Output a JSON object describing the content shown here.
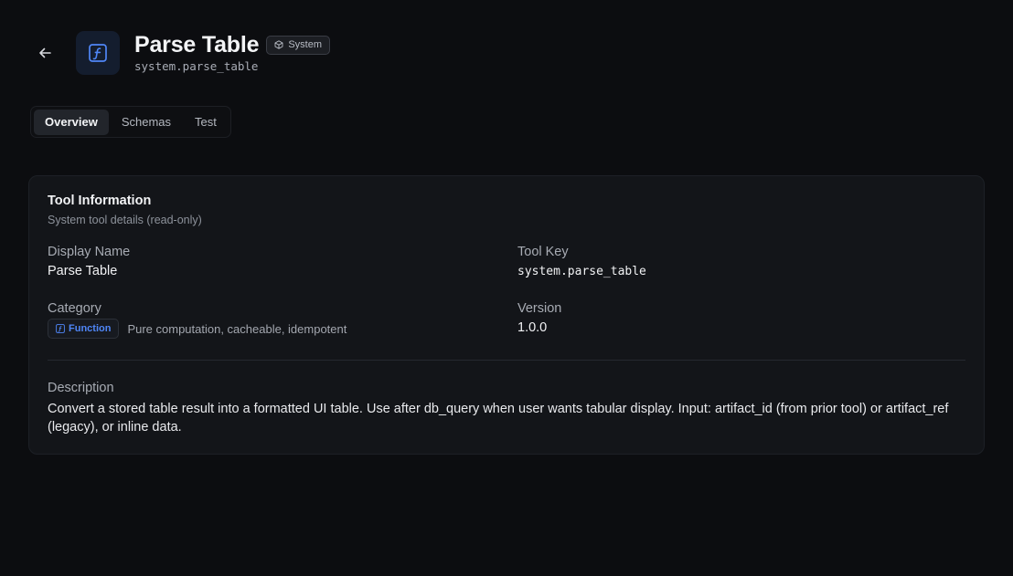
{
  "header": {
    "title": "Parse Table",
    "badge_label": "System",
    "tool_key_subtitle": "system.parse_table"
  },
  "tabs": [
    {
      "label": "Overview",
      "active": true
    },
    {
      "label": "Schemas",
      "active": false
    },
    {
      "label": "Test",
      "active": false
    }
  ],
  "card": {
    "title": "Tool Information",
    "subtitle": "System tool details (read-only)",
    "display_name_label": "Display Name",
    "display_name_value": "Parse Table",
    "tool_key_label": "Tool Key",
    "tool_key_value": "system.parse_table",
    "category_label": "Category",
    "category_badge": "Function",
    "category_description": "Pure computation, cacheable, idempotent",
    "version_label": "Version",
    "version_value": "1.0.0",
    "description_label": "Description",
    "description_value": "Convert a stored table result into a formatted UI table. Use after db_query when user wants tabular display. Input: artifact_id (from prior tool) or artifact_ref (legacy), or inline data."
  },
  "colors": {
    "background": "#0c0d10",
    "card": "#131519",
    "accent": "#4f86f7"
  },
  "icons": {
    "back": "arrow-left-icon",
    "tool": "function-icon",
    "system_badge": "cube-icon",
    "category": "function-icon"
  }
}
